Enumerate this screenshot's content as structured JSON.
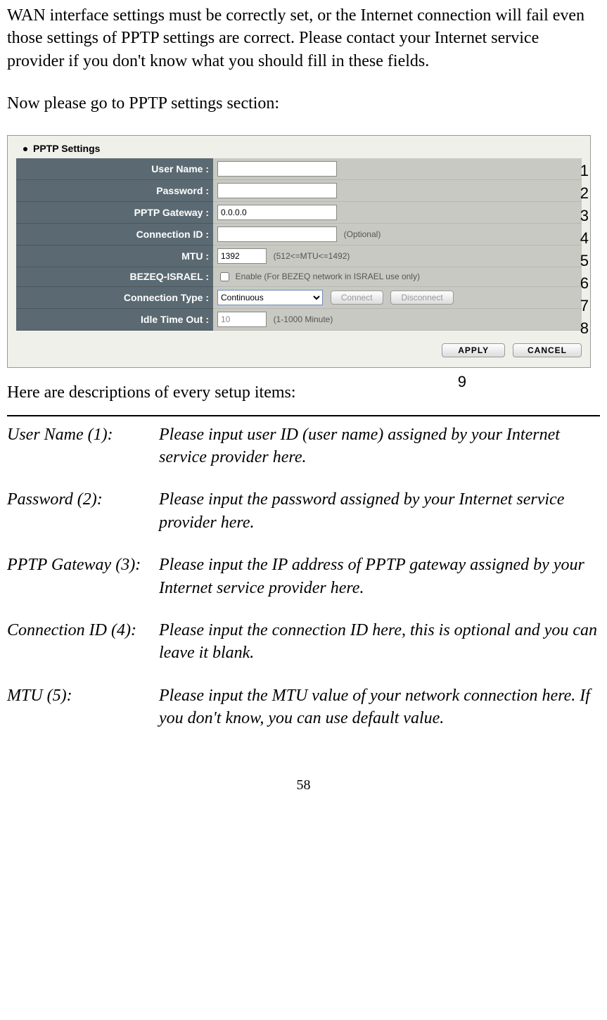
{
  "intro_para": "WAN interface settings must be correctly set, or the Internet connection will fail even those settings of PPTP settings are correct. Please contact your Internet service provider if you don't know what you should fill in these fields.",
  "lead_para": "Now please go to PPTP settings section:",
  "section_title": "PPTP Settings",
  "form": {
    "user_name_label": "User Name :",
    "user_name_value": "",
    "password_label": "Password :",
    "password_value": "",
    "gateway_label": "PPTP Gateway :",
    "gateway_value": "0.0.0.0",
    "conn_id_label": "Connection ID :",
    "conn_id_value": "",
    "conn_id_hint": "(Optional)",
    "mtu_label": "MTU :",
    "mtu_value": "1392",
    "mtu_hint": "(512<=MTU<=1492)",
    "bezeq_label": "BEZEQ-ISRAEL :",
    "bezeq_hint": "Enable (For BEZEQ network in ISRAEL use only)",
    "conn_type_label": "Connection Type :",
    "conn_type_value": "Continuous",
    "connect_btn": "Connect",
    "disconnect_btn": "Disconnect",
    "idle_label": "Idle Time Out :",
    "idle_value": "10",
    "idle_hint": "(1-1000 Minute)",
    "apply_btn": "APPLY",
    "cancel_btn": "CANCEL"
  },
  "callouts": {
    "c1": "1",
    "c2": "2",
    "c3": "3",
    "c4": "4",
    "c5": "5",
    "c6": "6",
    "c7": "7",
    "c8": "8",
    "c9": "9"
  },
  "desc_intro": "Here are descriptions of every setup items:",
  "defs": [
    {
      "term": "User Name (1):",
      "desc": "Please input user ID (user name) assigned by your Internet service provider here."
    },
    {
      "term": "Password (2):",
      "desc": "Please input the password assigned by your Internet service provider here."
    },
    {
      "term": "PPTP Gateway (3):",
      "desc": "Please input the IP address of PPTP gateway assigned by your Internet service provider here."
    },
    {
      "term": "Connection ID (4):",
      "desc": "Please input the connection ID here, this is optional and you can leave it blank."
    },
    {
      "term": "MTU (5):",
      "desc": "Please input the MTU value of your network connection here. If you don't know, you can use default value."
    }
  ],
  "page_number": "58"
}
